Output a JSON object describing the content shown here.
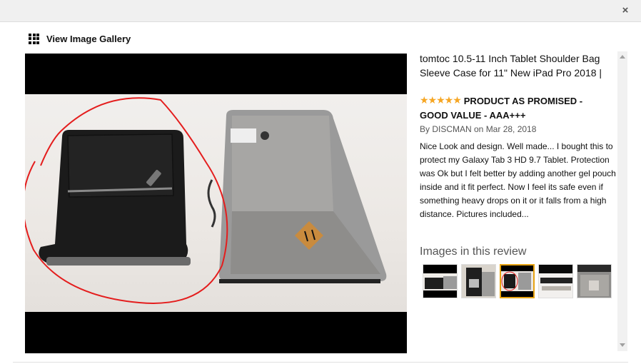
{
  "dialog": {
    "close_glyph": "×"
  },
  "gallery": {
    "label": "View Image Gallery",
    "icon": "grid-icon"
  },
  "product": {
    "title": "tomtoc 10.5-11 Inch Tablet Shoulder Bag Sleeve Case for 11\" New iPad Pro 2018 |"
  },
  "review": {
    "stars": "★★★★★",
    "rating": 5,
    "title": "PRODUCT AS PROMISED - GOOD VALUE - AAA+++",
    "meta": "By DISCMAN on Mar 28, 2018",
    "body": "Nice Look and design. Well made... I bought this to protect my Galaxy Tab 3 HD 9.7 Tablet. Protection was Ok but I felt better by adding another gel pouch inside and it fit perfect. Now I feel its safe even if something heavy drops on it or it falls from a high distance. Pictures included..."
  },
  "review_images": {
    "heading": "Images in this review",
    "count": 5,
    "selected_index": 2
  },
  "colors": {
    "accent_star": "#f6a623",
    "selected_border": "#e7a312",
    "annotation": "#e41d1d"
  }
}
